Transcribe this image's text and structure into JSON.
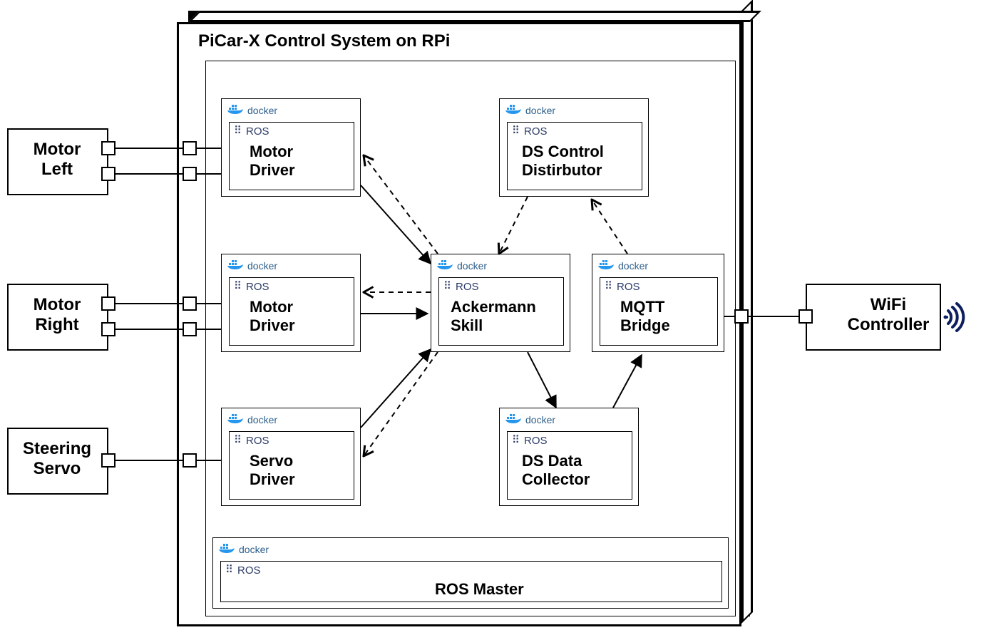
{
  "title": "PiCar-X Control System on RPi",
  "docker_label": "docker",
  "ros_label": "ROS",
  "external": {
    "motor_left": "Motor\nLeft",
    "motor_right": "Motor\nRight",
    "steering_servo": "Steering\nServo",
    "wifi_controller": "WiFi\nController"
  },
  "nodes": {
    "motor_driver_top": "Motor\nDriver",
    "motor_driver_mid": "Motor\nDriver",
    "servo_driver": "Servo\nDriver",
    "ackermann": "Ackermann\nSkill",
    "ds_control": "DS Control\nDistirbutor",
    "mqtt_bridge": "MQTT\nBridge",
    "ds_data": "DS Data\nCollector",
    "ros_master": "ROS Master"
  },
  "colors": {
    "docker_blue": "#2496ed",
    "ros_navy": "#2b3a67",
    "wifi_navy": "#1a2a6c"
  }
}
